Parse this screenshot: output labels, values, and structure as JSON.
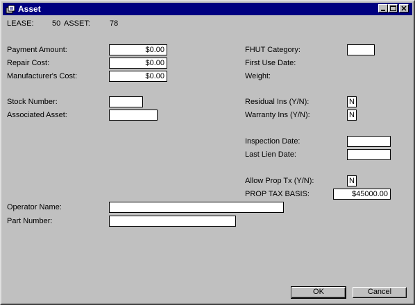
{
  "window": {
    "title": "Asset",
    "minimize_icon": "minimize-icon",
    "maximize_icon": "maximize-icon",
    "close_icon": "close-icon"
  },
  "header": {
    "lease_label": "LEASE:",
    "lease_value": "50",
    "asset_label": "ASSET:",
    "asset_value": "78"
  },
  "left": {
    "payment_amount": {
      "label": "Payment Amount:",
      "value": "$0.00"
    },
    "repair_cost": {
      "label": "Repair Cost:",
      "value": "$0.00"
    },
    "manufacturers_cost": {
      "label": "Manufacturer's Cost:",
      "value": "$0.00"
    },
    "stock_number": {
      "label": "Stock Number:",
      "value": ""
    },
    "associated_asset": {
      "label": "Associated Asset:",
      "value": ""
    },
    "operator_name": {
      "label": "Operator Name:",
      "value": ""
    },
    "part_number": {
      "label": "Part Number:",
      "value": ""
    }
  },
  "right": {
    "fhut_category": {
      "label": "FHUT Category:",
      "value": ""
    },
    "first_use_date": {
      "label": "First Use Date:"
    },
    "weight": {
      "label": "Weight:"
    },
    "residual_ins": {
      "label": "Residual Ins (Y/N):",
      "value": "N"
    },
    "warranty_ins": {
      "label": "Warranty Ins (Y/N):",
      "value": "N"
    },
    "inspection_date": {
      "label": "Inspection Date:",
      "value": ""
    },
    "last_lien_date": {
      "label": "Last Lien Date:",
      "value": ""
    },
    "allow_prop_tx": {
      "label": "Allow Prop Tx (Y/N):",
      "value": "N"
    },
    "prop_tax_basis": {
      "label": "PROP TAX BASIS:",
      "value": "$45000.00"
    }
  },
  "buttons": {
    "ok": "OK",
    "cancel": "Cancel"
  }
}
